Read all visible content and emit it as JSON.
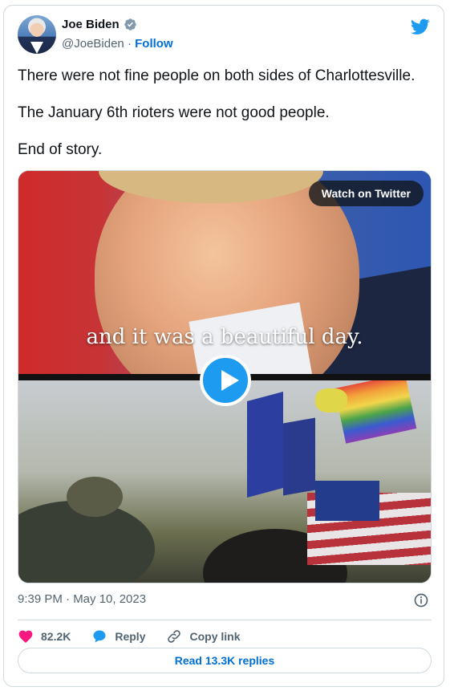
{
  "author": {
    "name": "Joe Biden",
    "handle": "@JoeBiden",
    "separator": "·",
    "follow_label": "Follow",
    "verified": true
  },
  "tweet": {
    "paragraphs": [
      "There were not fine people on both sides of Charlottesville.",
      "The January 6th rioters were not good people.",
      "End of story."
    ]
  },
  "media": {
    "type": "video",
    "caption": "and it was a beautiful day.",
    "watch_label": "Watch on Twitter",
    "play_icon": "play-icon"
  },
  "meta": {
    "timestamp": "9:39 PM · May 10, 2023",
    "info_icon": "info-icon"
  },
  "actions": {
    "like_count": "82.2K",
    "reply_label": "Reply",
    "copy_link_label": "Copy link",
    "read_replies_label": "Read 13.3K replies"
  },
  "colors": {
    "accent": "#1d9bf0",
    "link": "#006fd6",
    "like": "#f91880",
    "muted": "#536471",
    "border": "#cfd9de"
  }
}
